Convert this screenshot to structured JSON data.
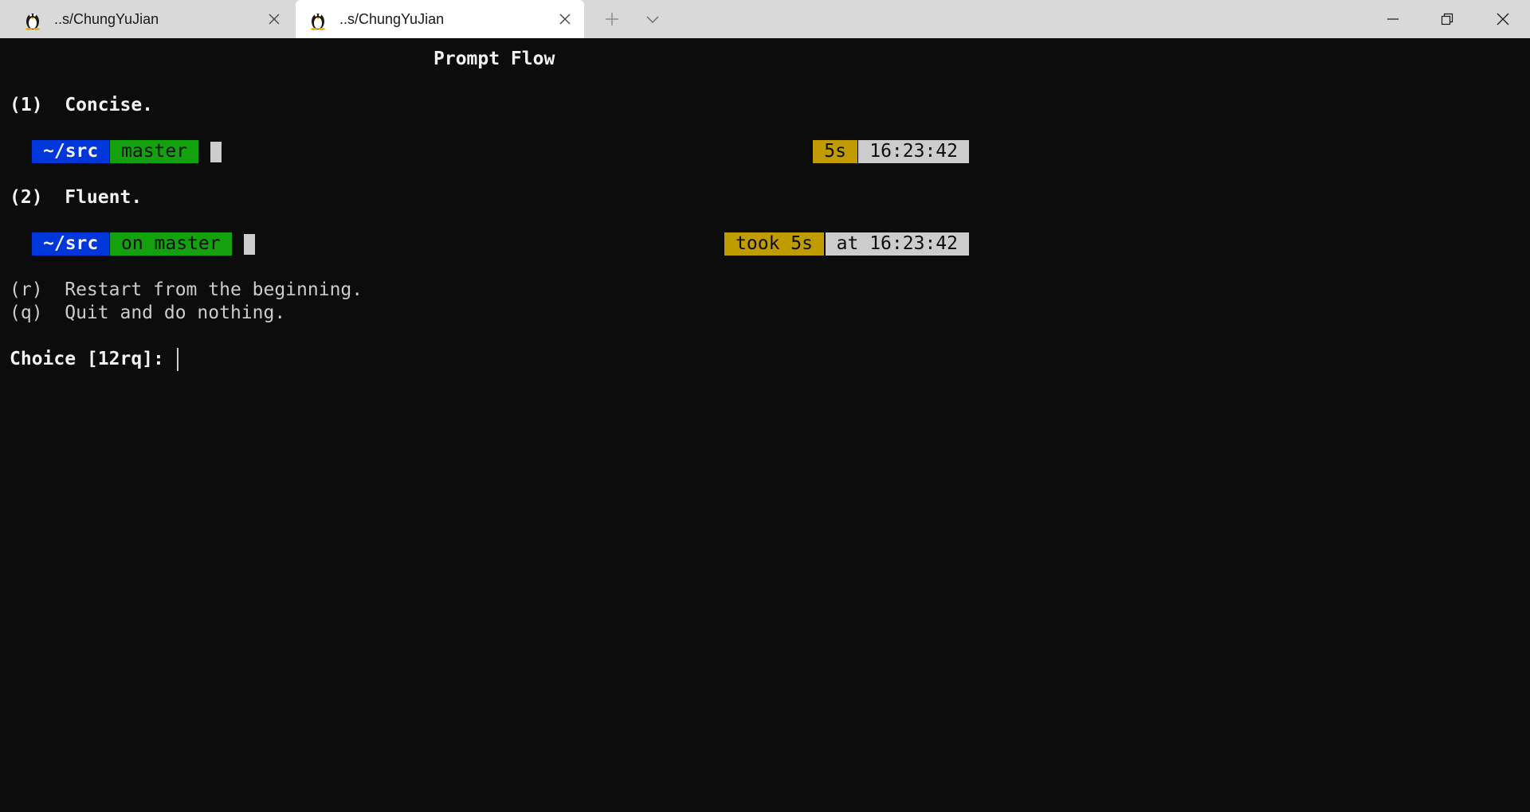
{
  "tabs": [
    {
      "label": "..s/ChungYuJian",
      "icon": "tux-icon",
      "active": false
    },
    {
      "label": "..s/ChungYuJian",
      "icon": "tux-icon",
      "active": true
    }
  ],
  "titlebar": {
    "new_tab_icon": "plus-icon",
    "dropdown_icon": "chevron-down-icon",
    "window_controls": [
      "minimize-icon",
      "restore-icon",
      "close-icon"
    ]
  },
  "terminal": {
    "title": "Prompt Flow",
    "options": {
      "opt1": "(1)  Concise.",
      "opt2": "(2)  Fluent.",
      "optr": "(r)  Restart from the beginning.",
      "optq": "(q)  Quit and do nothing."
    },
    "concise_prompt": {
      "path": "~/src",
      "branch": "master",
      "duration": "5s",
      "time": "16:23:42"
    },
    "fluent_prompt": {
      "path": "~/src",
      "branch": "on master",
      "duration": "took 5s",
      "time": "at 16:23:42"
    },
    "choice_prompt": "Choice [12rq]: "
  },
  "colors": {
    "background": "#0c0c0c",
    "path_bg": "#0037da",
    "branch_bg": "#13a10e",
    "duration_bg": "#c19c00",
    "time_bg": "#cccccc"
  }
}
